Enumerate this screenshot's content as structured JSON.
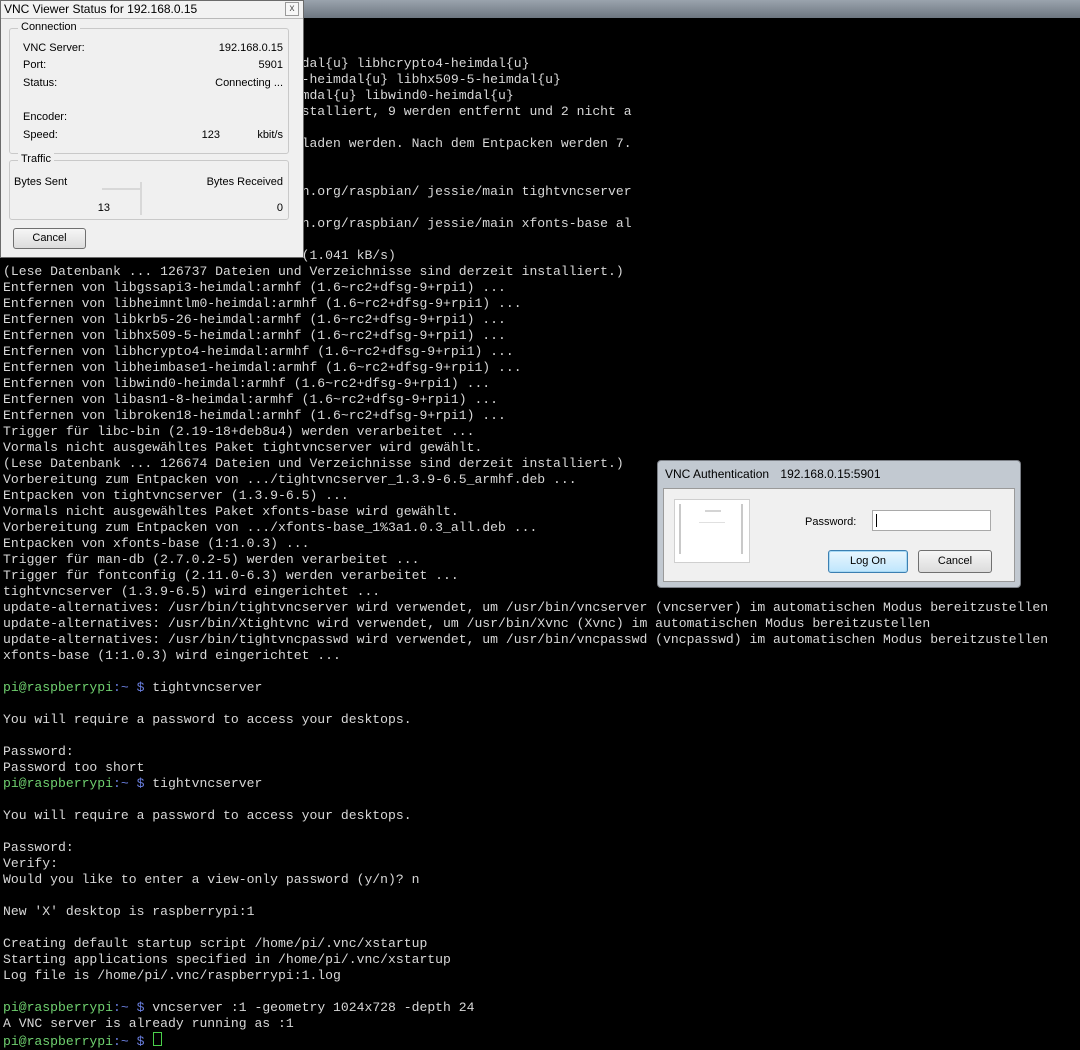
{
  "status_window": {
    "title": "VNC Viewer Status for 192.168.0.15",
    "close_glyph": "x",
    "connection": {
      "legend": "Connection",
      "server_label": "VNC Server:",
      "server_value": "192.168.0.15",
      "port_label": "Port:",
      "port_value": "5901",
      "status_label": "Status:",
      "status_value": "Connecting ...",
      "encoder_label": "Encoder:",
      "encoder_value": "",
      "speed_label": "Speed:",
      "speed_value": "123",
      "speed_unit": "kbit/s"
    },
    "traffic": {
      "legend": "Traffic",
      "sent_label": "Bytes Sent",
      "received_label": "Bytes Received",
      "sent_value": "13",
      "received_value": "0"
    },
    "cancel_label": "Cancel"
  },
  "auth_dialog": {
    "title": "VNC Authentication",
    "host": "192.168.0.15:5901",
    "password_label": "Password:",
    "password_value": "",
    "logon_label": "Log On",
    "cancel_label": "Cancel"
  },
  "terminal": {
    "lines": [
      {
        "text": "                                      dal{u} libhcrypto4-heimdal{u}"
      },
      {
        "text": "                                      -heimdal{u} libhx509-5-heimdal{u}"
      },
      {
        "text": "                                      mdal{u} libwind0-heimdal{u}"
      },
      {
        "text": "                                      stalliert, 9 werden entfernt und 2 nicht a"
      },
      {
        "text": ""
      },
      {
        "text": "                                      laden werden. Nach dem Entpacken werden 7."
      },
      {
        "text": ""
      },
      {
        "text": ""
      },
      {
        "text": "                                      n.org/raspbian/ jessie/main tightvncserver"
      },
      {
        "text": ""
      },
      {
        "text": "                                      n.org/raspbian/ jessie/main xfonts-base al"
      },
      {
        "text": ""
      },
      {
        "text": "                                      (1.041 kB/s)"
      },
      {
        "text": "(Lese Datenbank ... 126737 Dateien und Verzeichnisse sind derzeit installiert.)"
      },
      {
        "text": "Entfernen von libgssapi3-heimdal:armhf (1.6~rc2+dfsg-9+rpi1) ..."
      },
      {
        "text": "Entfernen von libheimntlm0-heimdal:armhf (1.6~rc2+dfsg-9+rpi1) ..."
      },
      {
        "text": "Entfernen von libkrb5-26-heimdal:armhf (1.6~rc2+dfsg-9+rpi1) ..."
      },
      {
        "text": "Entfernen von libhx509-5-heimdal:armhf (1.6~rc2+dfsg-9+rpi1) ..."
      },
      {
        "text": "Entfernen von libhcrypto4-heimdal:armhf (1.6~rc2+dfsg-9+rpi1) ..."
      },
      {
        "text": "Entfernen von libheimbase1-heimdal:armhf (1.6~rc2+dfsg-9+rpi1) ..."
      },
      {
        "text": "Entfernen von libwind0-heimdal:armhf (1.6~rc2+dfsg-9+rpi1) ..."
      },
      {
        "text": "Entfernen von libasn1-8-heimdal:armhf (1.6~rc2+dfsg-9+rpi1) ..."
      },
      {
        "text": "Entfernen von libroken18-heimdal:armhf (1.6~rc2+dfsg-9+rpi1) ..."
      },
      {
        "text": "Trigger für libc-bin (2.19-18+deb8u4) werden verarbeitet ..."
      },
      {
        "text": "Vormals nicht ausgewähltes Paket tightvncserver wird gewählt."
      },
      {
        "text": "(Lese Datenbank ... 126674 Dateien und Verzeichnisse sind derzeit installiert.)"
      },
      {
        "text": "Vorbereitung zum Entpacken von .../tightvncserver_1.3.9-6.5_armhf.deb ..."
      },
      {
        "text": "Entpacken von tightvncserver (1.3.9-6.5) ..."
      },
      {
        "text": "Vormals nicht ausgewähltes Paket xfonts-base wird gewählt."
      },
      {
        "text": "Vorbereitung zum Entpacken von .../xfonts-base_1%3a1.0.3_all.deb ..."
      },
      {
        "text": "Entpacken von xfonts-base (1:1.0.3) ..."
      },
      {
        "text": "Trigger für man-db (2.7.0.2-5) werden verarbeitet ..."
      },
      {
        "text": "Trigger für fontconfig (2.11.0-6.3) werden verarbeitet ..."
      },
      {
        "text": "tightvncserver (1.3.9-6.5) wird eingerichtet ..."
      },
      {
        "text": "update-alternatives: /usr/bin/tightvncserver wird verwendet, um /usr/bin/vncserver (vncserver) im automatischen Modus bereitzustellen"
      },
      {
        "text": "update-alternatives: /usr/bin/Xtightvnc wird verwendet, um /usr/bin/Xvnc (Xvnc) im automatischen Modus bereitzustellen"
      },
      {
        "text": "update-alternatives: /usr/bin/tightvncpasswd wird verwendet, um /usr/bin/vncpasswd (vncpasswd) im automatischen Modus bereitzustellen"
      },
      {
        "text": "xfonts-base (1:1.0.3) wird eingerichtet ..."
      },
      {
        "text": ""
      },
      {
        "user": "pi@raspberrypi",
        "path": ":~ $",
        "text": " tightvncserver"
      },
      {
        "text": ""
      },
      {
        "text": "You will require a password to access your desktops."
      },
      {
        "text": ""
      },
      {
        "text": "Password:"
      },
      {
        "text": "Password too short"
      },
      {
        "user": "pi@raspberrypi",
        "path": ":~ $",
        "text": " tightvncserver"
      },
      {
        "text": ""
      },
      {
        "text": "You will require a password to access your desktops."
      },
      {
        "text": ""
      },
      {
        "text": "Password:"
      },
      {
        "text": "Verify:"
      },
      {
        "text": "Would you like to enter a view-only password (y/n)? n"
      },
      {
        "text": ""
      },
      {
        "text": "New 'X' desktop is raspberrypi:1"
      },
      {
        "text": ""
      },
      {
        "text": "Creating default startup script /home/pi/.vnc/xstartup"
      },
      {
        "text": "Starting applications specified in /home/pi/.vnc/xstartup"
      },
      {
        "text": "Log file is /home/pi/.vnc/raspberrypi:1.log"
      },
      {
        "text": ""
      },
      {
        "user": "pi@raspberrypi",
        "path": ":~ $",
        "text": " vncserver :1 -geometry 1024x728 -depth 24"
      },
      {
        "text": "A VNC server is already running as :1"
      },
      {
        "user": "pi@raspberrypi",
        "path": ":~ $",
        "text": " ",
        "cursor": true
      }
    ]
  }
}
